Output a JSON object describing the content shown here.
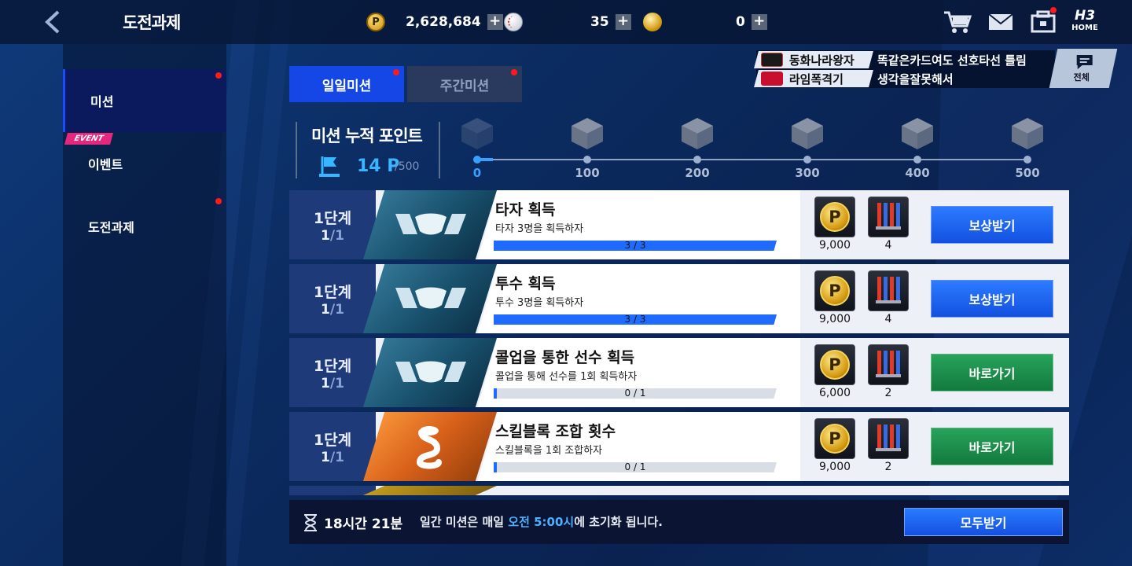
{
  "header": {
    "title": "도전과제",
    "points_value": "2,628,684",
    "ball_value": "35",
    "gold_value": "0",
    "home_label": "HOME"
  },
  "sidebar": {
    "items": [
      {
        "label": "미션"
      },
      {
        "label": "이벤트"
      },
      {
        "label": "도전과제"
      }
    ],
    "event_tag": "EVENT"
  },
  "tabs": [
    {
      "label": "일일미션"
    },
    {
      "label": "주간미션"
    }
  ],
  "ticker": {
    "items": [
      {
        "badge_logo": "BEARS",
        "name": "동화나라왕자",
        "message": "똑같은카드여도 선호타선 틀림"
      },
      {
        "badge_logo": "LANDERS",
        "name": "라임폭격기",
        "message": "생각을잘못해서"
      }
    ],
    "all_label": "전체"
  },
  "mission_points": {
    "title": "미션 누적 포인트",
    "value": "14 P",
    "max": "/500",
    "progress_fraction": 0.028,
    "milestones": [
      "0",
      "100",
      "200",
      "300",
      "400",
      "500"
    ]
  },
  "missions": [
    {
      "stage": "1단계",
      "count_done": "1",
      "count_total": "/1",
      "title": "타자 획득",
      "desc": "타자 3명을 획득하자",
      "progress_text": "3 / 3",
      "progress_fraction": 1.0,
      "reward1": "9,000",
      "reward2": "4",
      "button": "보상받기",
      "button_style": "blue",
      "art": "blue"
    },
    {
      "stage": "1단계",
      "count_done": "1",
      "count_total": "/1",
      "title": "투수 획득",
      "desc": "투수 3명을 획득하자",
      "progress_text": "3 / 3",
      "progress_fraction": 1.0,
      "reward1": "9,000",
      "reward2": "4",
      "button": "보상받기",
      "button_style": "blue",
      "art": "blue"
    },
    {
      "stage": "1단계",
      "count_done": "1",
      "count_total": "/1",
      "title": "콜업을 통한 선수 획득",
      "desc": "콜업을 통해 선수를 1회 획득하자",
      "progress_text": "0 / 1",
      "progress_fraction": 0.01,
      "reward1": "6,000",
      "reward2": "2",
      "button": "바로가기",
      "button_style": "green",
      "art": "blue"
    },
    {
      "stage": "1단계",
      "count_done": "1",
      "count_total": "/1",
      "title": "스킬블록 조합 횟수",
      "desc": "스킬블록을 1회 조합하자",
      "progress_text": "0 / 1",
      "progress_fraction": 0.01,
      "reward1": "9,000",
      "reward2": "2",
      "button": "바로가기",
      "button_style": "green",
      "art": "orange"
    }
  ],
  "footer": {
    "timer": "18시간 21분",
    "note_prefix": "일간 미션은 매일 ",
    "note_highlight": "오전 5:00시",
    "note_suffix": "에 초기화 됩니다.",
    "claim_all": "모두받기"
  },
  "colors": {
    "accent_blue": "#1447e6",
    "claim_blue": "#1f6bff",
    "goto_green": "#1a8a4a",
    "highlight": "#4ab0ff",
    "alert_red": "#ff1a1a"
  }
}
